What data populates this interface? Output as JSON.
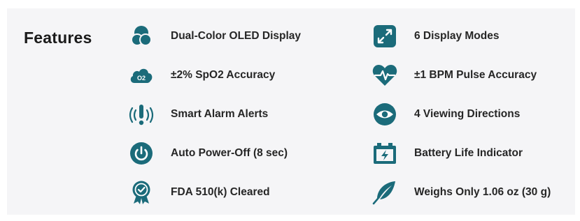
{
  "heading": "Features",
  "colors": {
    "icon": "#1b6b7a",
    "text": "#262626",
    "panel": "#f5f5f7"
  },
  "features": {
    "left": [
      {
        "label": "Dual-Color OLED Display",
        "icon": "dual-circle-icon"
      },
      {
        "label": "±2% SpO2 Accuracy",
        "icon": "o2-cloud-icon"
      },
      {
        "label": "Smart Alarm Alerts",
        "icon": "alarm-signal-icon"
      },
      {
        "label": "Auto Power-Off (8 sec)",
        "icon": "power-icon"
      },
      {
        "label": "FDA 510(k) Cleared",
        "icon": "certified-badge-icon"
      }
    ],
    "right": [
      {
        "label": "6 Display Modes",
        "icon": "expand-arrows-icon"
      },
      {
        "label": "±1 BPM Pulse Accuracy",
        "icon": "heart-pulse-icon"
      },
      {
        "label": "4 Viewing Directions",
        "icon": "eye-icon"
      },
      {
        "label": "Battery Life Indicator",
        "icon": "battery-icon"
      },
      {
        "label": "Weighs Only 1.06 oz (30 g)",
        "icon": "feather-icon"
      }
    ]
  }
}
